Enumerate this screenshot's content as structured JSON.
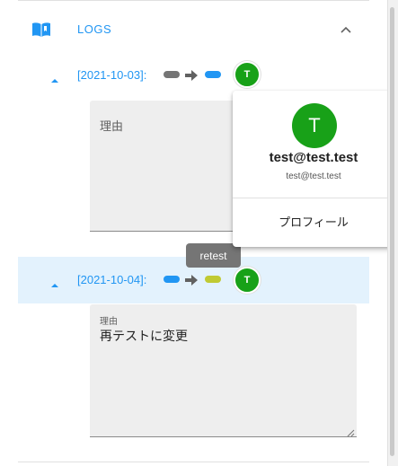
{
  "logs": {
    "title": "LOGS",
    "icons": {
      "section": "book-open-icon",
      "collapse": "chevron-up-icon"
    },
    "entries": [
      {
        "date": "[2021-10-03]:",
        "from_color": "#757575",
        "to_color": "#2196f3",
        "user_initial": "T",
        "reason_label": "理由",
        "reason_value": ""
      },
      {
        "date": "[2021-10-04]:",
        "from_color": "#2196f3",
        "to_color": "#c0ca33",
        "user_initial": "T",
        "reason_label": "理由",
        "reason_value": "再テストに変更"
      }
    ]
  },
  "tooltip": {
    "text": "retest"
  },
  "profile_popup": {
    "avatar_initial": "T",
    "name": "test@test.test",
    "email": "test@test.test",
    "profile_link": "プロフィール"
  },
  "colors": {
    "accent": "#2196f3",
    "avatar": "#18a118",
    "highlight_row": "#e3f2fd",
    "arrow": "#616161"
  }
}
